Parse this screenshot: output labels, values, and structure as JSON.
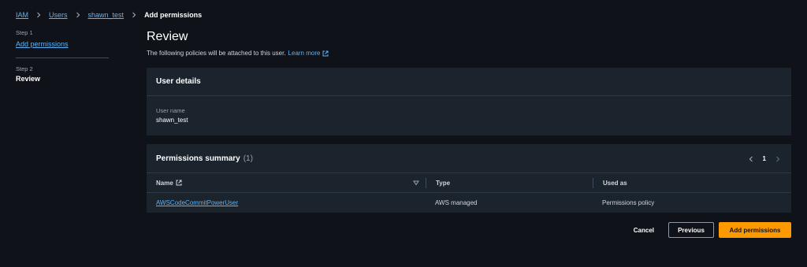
{
  "breadcrumb": {
    "items": [
      {
        "label": "IAM"
      },
      {
        "label": "Users"
      },
      {
        "label": "shawn_test"
      }
    ],
    "current": "Add permissions"
  },
  "steps": [
    {
      "step_label": "Step 1",
      "name": "Add permissions"
    },
    {
      "step_label": "Step 2",
      "name": "Review"
    }
  ],
  "page": {
    "title": "Review",
    "subtitle": "The following policies will be attached to this user.",
    "learn_more": "Learn more"
  },
  "user_details": {
    "heading": "User details",
    "field_label": "User name",
    "field_value": "shawn_test"
  },
  "permissions_summary": {
    "heading": "Permissions summary",
    "count": "(1)",
    "page_number": "1",
    "columns": [
      "Name",
      "Type",
      "Used as"
    ],
    "rows": [
      {
        "name": "AWSCodeCommitPowerUser",
        "type": "AWS managed",
        "used_as": "Permissions policy"
      }
    ]
  },
  "actions": {
    "cancel": "Cancel",
    "previous": "Previous",
    "add_permissions": "Add permissions"
  },
  "colors": {
    "background": "#0f1218",
    "panel": "#1b232d",
    "link": "#5eb3f6",
    "primary_button": "#ff9900"
  },
  "icons": [
    "chevron-right-icon",
    "external-link-icon",
    "chevron-left-icon",
    "sort-down-icon"
  ]
}
